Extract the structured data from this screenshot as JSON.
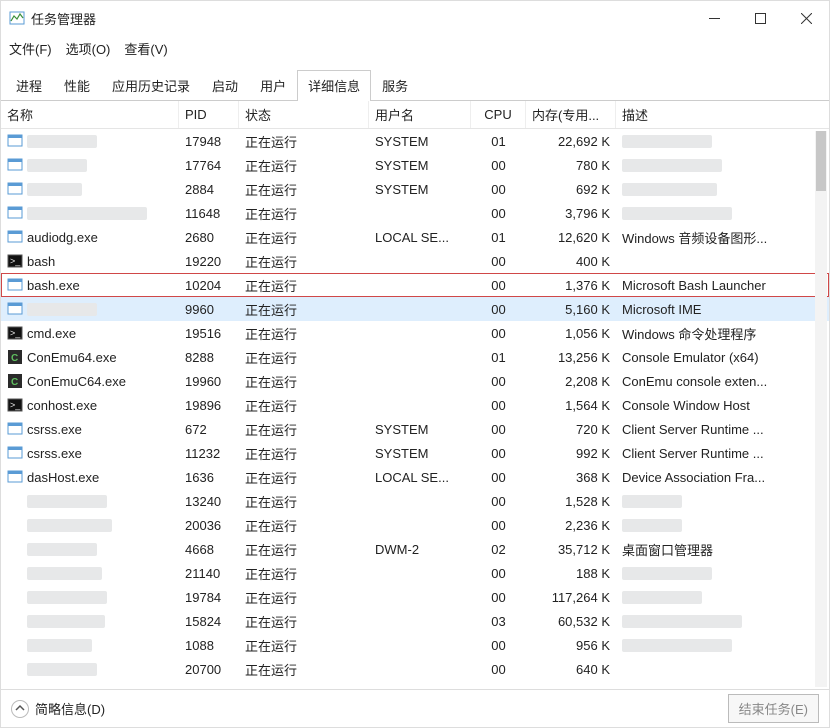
{
  "window": {
    "title": "任务管理器"
  },
  "menu": {
    "file": "文件(F)",
    "options": "选项(O)",
    "view": "查看(V)"
  },
  "tabs": {
    "processes": "进程",
    "performance": "性能",
    "history": "应用历史记录",
    "startup": "启动",
    "users": "用户",
    "details": "详细信息",
    "services": "服务"
  },
  "columns": {
    "name": "名称",
    "pid": "PID",
    "status": "状态",
    "user": "用户名",
    "cpu": "CPU",
    "mem": "内存(专用...",
    "desc": "描述"
  },
  "status_running": "正在运行",
  "rows": [
    {
      "name": "",
      "blurName": 70,
      "icon": "generic",
      "pid": "17948",
      "user": "SYSTEM",
      "cpu": "01",
      "mem": "22,692 K",
      "desc": "",
      "blurDesc": 90
    },
    {
      "name": "",
      "blurName": 60,
      "icon": "generic",
      "pid": "17764",
      "user": "SYSTEM",
      "cpu": "00",
      "mem": "780 K",
      "desc": "",
      "blurDesc": 100
    },
    {
      "name": "",
      "blurName": 55,
      "icon": "generic",
      "pid": "2884",
      "user": "SYSTEM",
      "cpu": "00",
      "mem": "692 K",
      "desc": "",
      "blurDesc": 95
    },
    {
      "name": "",
      "blurName": 120,
      "icon": "generic",
      "pid": "11648",
      "user": "",
      "cpu": "00",
      "mem": "3,796 K",
      "desc": "",
      "blurDesc": 110
    },
    {
      "name": "audiodg.exe",
      "icon": "generic",
      "pid": "2680",
      "user": "LOCAL SE...",
      "cpu": "01",
      "mem": "12,620 K",
      "desc": "Windows 音频设备图形..."
    },
    {
      "name": "bash",
      "icon": "term",
      "pid": "19220",
      "user": "",
      "cpu": "00",
      "mem": "400 K",
      "desc": ""
    },
    {
      "name": "bash.exe",
      "icon": "generic",
      "pid": "10204",
      "user": "",
      "cpu": "00",
      "mem": "1,376 K",
      "desc": "Microsoft Bash Launcher",
      "highlight": true
    },
    {
      "name": "",
      "blurName": 70,
      "icon": "generic",
      "pid": "9960",
      "user": "",
      "cpu": "00",
      "mem": "5,160 K",
      "desc": "Microsoft IME",
      "selected": true
    },
    {
      "name": "cmd.exe",
      "icon": "term",
      "pid": "19516",
      "user": "",
      "cpu": "00",
      "mem": "1,056 K",
      "desc": "Windows 命令处理程序"
    },
    {
      "name": "ConEmu64.exe",
      "icon": "conemu",
      "pid": "8288",
      "user": "",
      "cpu": "01",
      "mem": "13,256 K",
      "desc": "Console Emulator (x64)"
    },
    {
      "name": "ConEmuC64.exe",
      "icon": "conemu",
      "pid": "19960",
      "user": "",
      "cpu": "00",
      "mem": "2,208 K",
      "desc": "ConEmu console exten..."
    },
    {
      "name": "conhost.exe",
      "icon": "term",
      "pid": "19896",
      "user": "",
      "cpu": "00",
      "mem": "1,564 K",
      "desc": "Console Window Host"
    },
    {
      "name": "csrss.exe",
      "icon": "generic",
      "pid": "672",
      "user": "SYSTEM",
      "cpu": "00",
      "mem": "720 K",
      "desc": "Client Server Runtime ..."
    },
    {
      "name": "csrss.exe",
      "icon": "generic",
      "pid": "11232",
      "user": "SYSTEM",
      "cpu": "00",
      "mem": "992 K",
      "desc": "Client Server Runtime ..."
    },
    {
      "name": "dasHost.exe",
      "icon": "generic",
      "pid": "1636",
      "user": "LOCAL SE...",
      "cpu": "00",
      "mem": "368 K",
      "desc": "Device Association Fra..."
    },
    {
      "name": "",
      "blurName": 80,
      "icon": "none",
      "pid": "13240",
      "user": "",
      "cpu": "00",
      "mem": "1,528 K",
      "desc": "",
      "blurDesc": 60
    },
    {
      "name": "",
      "blurName": 85,
      "icon": "none",
      "pid": "20036",
      "user": "",
      "cpu": "00",
      "mem": "2,236 K",
      "desc": "",
      "blurDesc": 60
    },
    {
      "name": "",
      "blurName": 70,
      "icon": "none",
      "pid": "4668",
      "user": "DWM-2",
      "cpu": "02",
      "mem": "35,712 K",
      "desc": "桌面窗口管理器"
    },
    {
      "name": "",
      "blurName": 75,
      "icon": "none",
      "pid": "21140",
      "user": "",
      "cpu": "00",
      "mem": "188 K",
      "desc": "",
      "blurDesc": 90
    },
    {
      "name": "",
      "blurName": 80,
      "icon": "none",
      "pid": "19784",
      "user": "",
      "cpu": "00",
      "mem": "117,264 K",
      "desc": "",
      "blurDesc": 80
    },
    {
      "name": "",
      "blurName": 78,
      "icon": "none",
      "pid": "15824",
      "user": "",
      "cpu": "03",
      "mem": "60,532 K",
      "desc": "",
      "blurDesc": 120
    },
    {
      "name": "",
      "blurName": 65,
      "icon": "none",
      "pid": "1088",
      "user": "",
      "cpu": "00",
      "mem": "956 K",
      "desc": "",
      "blurDesc": 110
    },
    {
      "name": "",
      "blurName": 70,
      "icon": "none",
      "pid": "20700",
      "user": "",
      "cpu": "00",
      "mem": "640 K",
      "desc": "",
      "blurDesc": 0
    }
  ],
  "footer": {
    "fewer": "简略信息(D)",
    "end": "结束任务(E)"
  }
}
